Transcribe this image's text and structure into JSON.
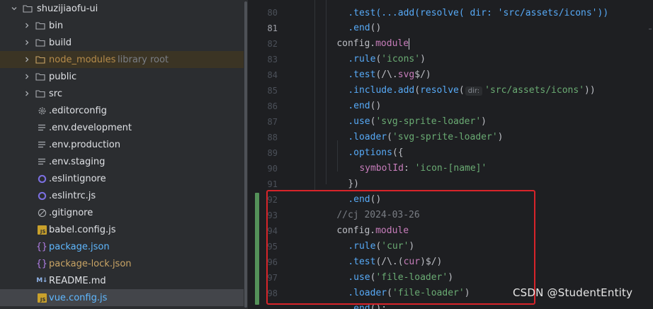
{
  "project_tree": {
    "root": {
      "name": "shuzijiaofu-ui",
      "icon": "folder-icon"
    },
    "items": [
      {
        "name": "bin",
        "type": "folder",
        "icon": "folder-icon"
      },
      {
        "name": "build",
        "type": "folder",
        "icon": "folder-icon"
      },
      {
        "name": "node_modules",
        "type": "folder",
        "icon": "folder-icon",
        "hint": "library root"
      },
      {
        "name": "public",
        "type": "folder",
        "icon": "folder-icon"
      },
      {
        "name": "src",
        "type": "folder",
        "icon": "folder-icon"
      },
      {
        "name": ".editorconfig",
        "type": "file",
        "icon": "gear-icon"
      },
      {
        "name": ".env.development",
        "type": "file",
        "icon": "text-lines-icon"
      },
      {
        "name": ".env.production",
        "type": "file",
        "icon": "text-lines-icon"
      },
      {
        "name": ".env.staging",
        "type": "file",
        "icon": "text-lines-icon"
      },
      {
        "name": ".eslintignore",
        "type": "file",
        "icon": "eslint-icon"
      },
      {
        "name": ".eslintrc.js",
        "type": "file",
        "icon": "eslint-icon"
      },
      {
        "name": ".gitignore",
        "type": "file",
        "icon": "gitignore-icon"
      },
      {
        "name": "babel.config.js",
        "type": "file",
        "icon": "js-file-icon",
        "badge": "JS"
      },
      {
        "name": "package.json",
        "type": "file",
        "icon": "json-file-icon",
        "glyph": "{}"
      },
      {
        "name": "package-lock.json",
        "type": "file",
        "icon": "json-file-icon",
        "glyph": "{}"
      },
      {
        "name": "README.md",
        "type": "file",
        "icon": "markdown-file-icon",
        "badge": "M↓"
      },
      {
        "name": "vue.config.js",
        "type": "file",
        "icon": "js-file-icon",
        "badge": "JS",
        "selected": true
      }
    ]
  },
  "editor": {
    "line_numbers": [
      "80",
      "81",
      "82",
      "83",
      "84",
      "85",
      "86",
      "87",
      "88",
      "89",
      "90",
      "91",
      "92",
      "93",
      "94",
      "95",
      "96",
      "97",
      "98"
    ],
    "top_partial_code": ".test(...add(resolve( dir: 'src/assets/icons'))",
    "lines": {
      "l80": {
        "end": ".end",
        "paren": "()"
      },
      "l81": {
        "obj": "config",
        "dot": ".",
        "prop": "module"
      },
      "l82": {
        "fn": ".rule",
        "open": "(",
        "str": "'icons'",
        "close": ")"
      },
      "l83": {
        "fn": ".test",
        "regex_open": "(/\\.",
        "regex_prop": "svg",
        "regex_close": "$/)"
      },
      "l84": {
        "fn1": ".include",
        "fn2": ".add",
        "fn3": "resolve",
        "open": "(",
        "inlay": "dir:",
        "str": "'src/assets/icons'",
        "close": "))"
      },
      "l85": {
        "fn": ".end",
        "paren": "()"
      },
      "l86": {
        "fn": ".use",
        "open": "(",
        "str": "'svg-sprite-loader'",
        "close": ")"
      },
      "l87": {
        "fn": ".loader",
        "open": "(",
        "str": "'svg-sprite-loader'",
        "close": ")"
      },
      "l88": {
        "fn": ".options",
        "open": "({"
      },
      "l89": {
        "key": "symbolId",
        "colon": ": ",
        "str": "'icon-[name]'"
      },
      "l90": {
        "close": "})"
      },
      "l91": {
        "fn": ".end",
        "paren": "()"
      },
      "l92": {
        "comment": "//cj 2024-03-26"
      },
      "l93": {
        "obj": "config",
        "dot": ".",
        "prop": "module"
      },
      "l94": {
        "fn": ".rule",
        "open": "(",
        "str": "'cur'",
        "close": ")"
      },
      "l95": {
        "fn": ".test",
        "regex_open": "(/\\.(",
        "regex_prop": "cur",
        "regex_close": ")$/)"
      },
      "l96": {
        "fn": ".use",
        "open": "(",
        "str": "'file-loader'",
        "close": ")"
      },
      "l97": {
        "fn": ".loader",
        "open": "(",
        "str": "'file-loader'",
        "close": ")"
      },
      "l98": {
        "fn": ".end",
        "paren": "();"
      }
    },
    "current_line": "81"
  },
  "watermark": "CSDN @StudentEntity",
  "colors": {
    "highlight_box": "#d8242a",
    "vcs_change_bar": "#549159",
    "selected_file": "#5fb8ff",
    "excluded_folder": "#b58b4a"
  }
}
